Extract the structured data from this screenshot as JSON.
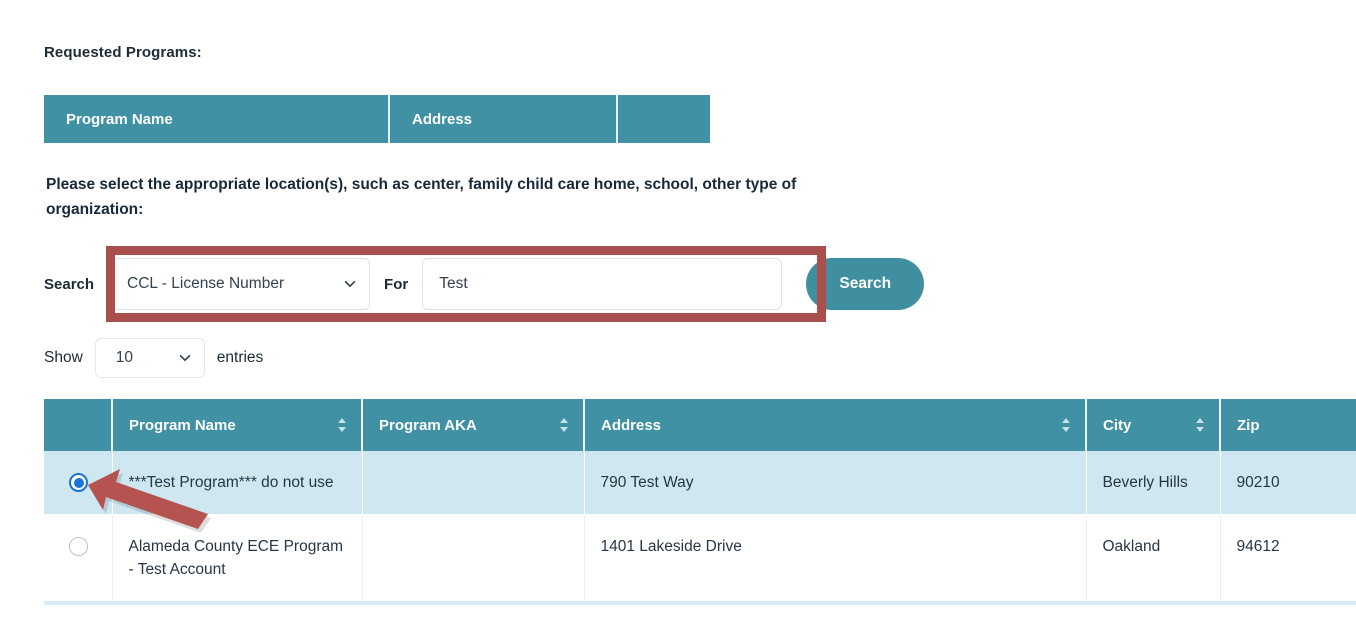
{
  "requested_programs": {
    "label": "Requested Programs:",
    "columns": [
      "Program Name",
      "Address",
      ""
    ]
  },
  "instruction": "Please select the appropriate location(s), such as center, family child care home, school, other type of organization:",
  "search": {
    "search_label": "Search",
    "type_value": "CCL - License Number",
    "for_label": "For",
    "term_value": "Test",
    "term_placeholder": "",
    "button_label": "Search",
    "highlight_color": "#a9504f"
  },
  "show_entries": {
    "show_label": "Show",
    "value": "10",
    "entries_label": "entries"
  },
  "results": {
    "columns": [
      "",
      "Program Name",
      "Program AKA",
      "Address",
      "City",
      "Zip"
    ],
    "rows": [
      {
        "selected": true,
        "program_name": "***Test Program*** do not use",
        "program_aka": "",
        "address": "790 Test Way",
        "city": "Beverly Hills",
        "zip": "90210"
      },
      {
        "selected": false,
        "program_name": "Alameda County ECE Program - Test Account",
        "program_aka": "",
        "address": "1401 Lakeside Drive",
        "city": "Oakland",
        "zip": "94612"
      }
    ]
  },
  "theme": {
    "header_teal": "#3f91a3",
    "selected_row_blue": "#cfe7f1",
    "annotation_red": "#a9504f",
    "radio_blue": "#1574d6"
  }
}
